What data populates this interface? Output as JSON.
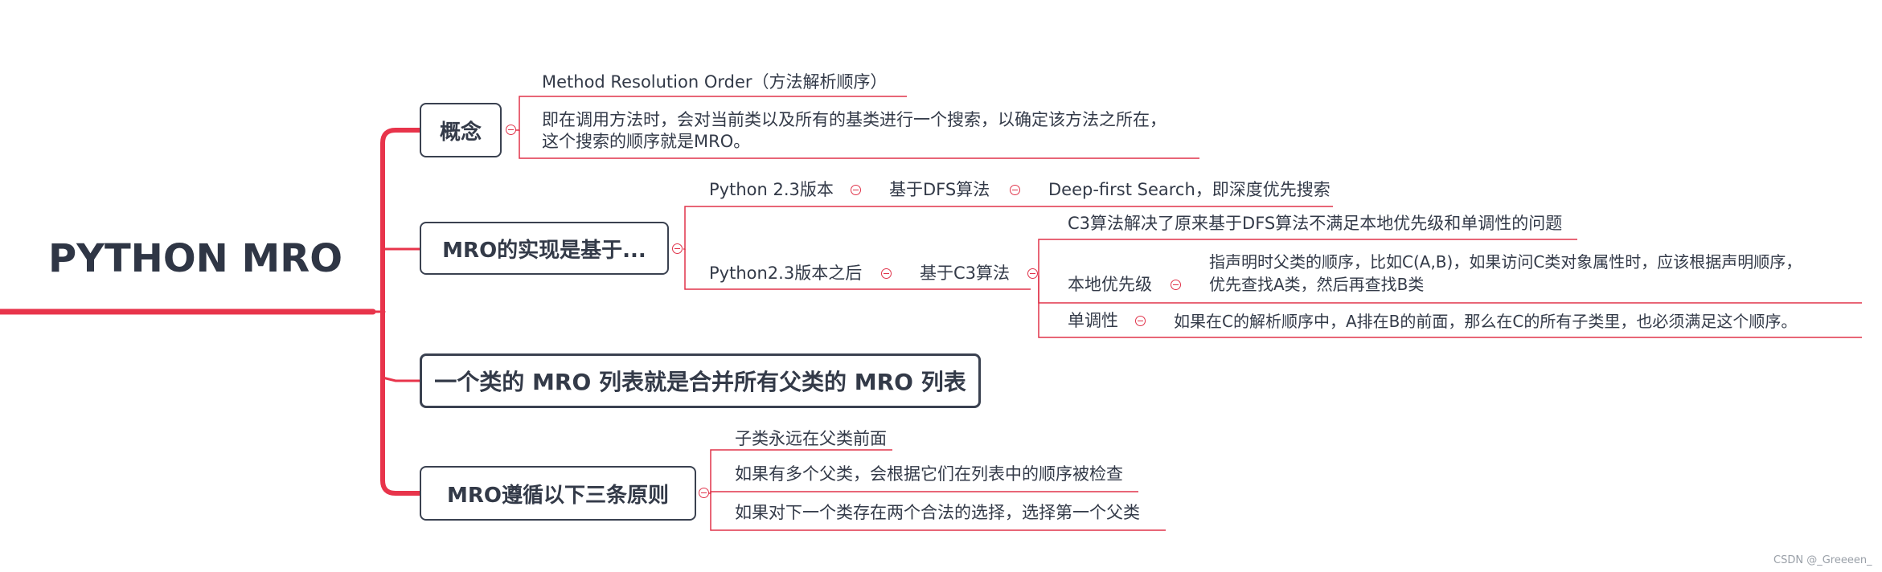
{
  "root": {
    "title": "PYTHON MRO"
  },
  "branches": {
    "concept": {
      "label": "概念",
      "children": [
        "Method Resolution Order（方法解析顺序）",
        "即在调用方法时，会对当前类以及所有的基类进行一个搜索，以确定该方法之所在，",
        "这个搜索的顺序就是MRO。"
      ]
    },
    "impl": {
      "label": "MRO的实现是基于...",
      "py23": "Python 2.3版本",
      "dfs": "基于DFS算法",
      "dfs_desc": "Deep-first Search，即深度优先搜索",
      "py23_after": "Python2.3版本之后",
      "c3": "基于C3算法",
      "c3_desc": "C3算法解决了原来基于DFS算法不满足本地优先级和单调性的问题",
      "local_priority": "本地优先级",
      "local_priority_desc_1": "指声明时父类的顺序，比如C(A,B)，如果访问C类对象属性时，应该根据声明顺序，",
      "local_priority_desc_2": "优先查找A类，然后再查找B类",
      "monotonic": "单调性",
      "monotonic_desc": "如果在C的解析顺序中，A排在B的前面，那么在C的所有子类里，也必须满足这个顺序。"
    },
    "merge": {
      "label": "一个类的 MRO 列表就是合并所有父类的 MRO 列表"
    },
    "rules": {
      "label": "MRO遵循以下三条原则",
      "children": [
        "子类永远在父类前面",
        "如果有多个父类，会根据它们在列表中的顺序被检查",
        "如果对下一个类存在两个合法的选择，选择第一个父类"
      ]
    }
  },
  "watermark": "CSDN @_Greeeen_",
  "colors": {
    "accent": "#e0334a",
    "root_line": "#e8344b",
    "text": "#333a48"
  }
}
